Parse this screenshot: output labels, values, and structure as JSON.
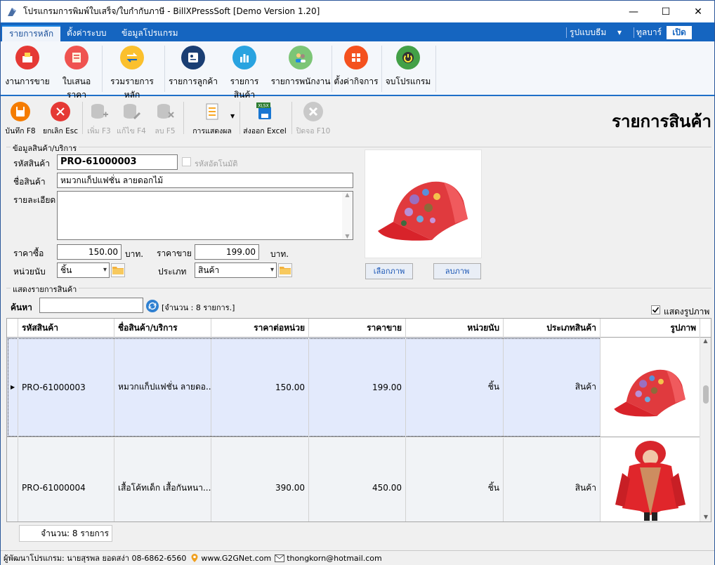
{
  "window": {
    "title": "โปรแกรมการพิมพ์ใบเสร็จ/ใบกำกับภาษี - BillXPressSoft [Demo Version 1.20]",
    "minimize": "—",
    "maximize": "☐",
    "close": "✕"
  },
  "tabs": {
    "main": "รายการหลัก",
    "settings": "ตั้งค่าระบบ",
    "about": "ข้อมูลโปรแกรม",
    "theme": "รูปแบบธีม",
    "theme_arrow": "▾",
    "toolbar_label": "ทูลบาร์",
    "open": "เปิด"
  },
  "ribbon": {
    "sales": "งานการขาย",
    "quotation": "ใบเสนอราคา",
    "summary": "รวมรายการหลัก",
    "customers": "รายการลูกค้า",
    "products": "รายการสินค้า",
    "employees": "รายการพนักงาน",
    "business": "ตั้งค่ากิจการ",
    "exit": "จบโปรแกรม"
  },
  "toolbar": {
    "save": "บันทึก F8",
    "cancel": "ยกเลิก Esc",
    "add": "เพิ่ม F3",
    "edit": "แก้ไข F4",
    "delete": "ลบ F5",
    "display": "การแสดงผล",
    "export": "ส่งออก Excel",
    "close": "ปิดจอ F10",
    "xlsx_badge": "XLSX"
  },
  "page_title": "รายการสินค้า",
  "form": {
    "legend": "ข้อมูลสินค้า/บริการ",
    "code_label": "รหัสสินค้า",
    "code_value": "PRO-61000003",
    "auto_code_label": "รหัสอัตโนมัติ",
    "name_label": "ชื่อสินค้า",
    "name_value": "หมวกแก็ปแฟชั่น ลายดอกไม้",
    "detail_label": "รายละเอียด",
    "detail_value": "",
    "cost_label": "ราคาซื้อ",
    "cost_value": "150.00",
    "baht1": "บาท.",
    "price_label": "ราคาขาย",
    "price_value": "199.00",
    "baht2": "บาท.",
    "unit_label": "หน่วยนับ",
    "unit_value": "ชิ้น",
    "type_label": "ประเภท",
    "type_value": "สินค้า",
    "select_image": "เลือกภาพ",
    "delete_image": "ลบภาพ"
  },
  "list": {
    "legend": "แสดงรายการสินค้า",
    "search_label": "ค้นหา",
    "search_value": "",
    "count_text": "[จำนวน : 8 รายการ.]",
    "show_image_label": "แสดงรูปภาพ",
    "show_image_checked": true
  },
  "grid": {
    "columns": [
      "รหัสสินค้า",
      "ชื่อสินค้า/บริการ",
      "ราคาต่อหน่วย",
      "ราคาขาย",
      "หน่วยนับ",
      "ประเภทสินค้า",
      "รูปภาพ"
    ],
    "rows": [
      {
        "code": "PRO-61000003",
        "name": "หมวกแก็ปแฟชั่น ลายดอ...",
        "cost": "150.00",
        "price": "199.00",
        "unit": "ชิ้น",
        "type": "สินค้า",
        "image": "floral-cap",
        "selected": true
      },
      {
        "code": "PRO-61000004",
        "name": "เสื้อโค้ทเด็ก เสื้อกันหนา...",
        "cost": "390.00",
        "price": "450.00",
        "unit": "ชิ้น",
        "type": "สินค้า",
        "image": "red-kids-jacket",
        "selected": false
      }
    ],
    "footer_count": "จำนวน: 8 รายการ"
  },
  "status": {
    "developer": "ผู้พัฒนาโปรแกรม: นายสุรพล ยอดสง่า 08-6862-6560",
    "website": "www.G2GNet.com",
    "email": "thongkorn@hotmail.com"
  },
  "colors": {
    "accent": "#1565c0",
    "selected_row": "#e3eafc"
  }
}
